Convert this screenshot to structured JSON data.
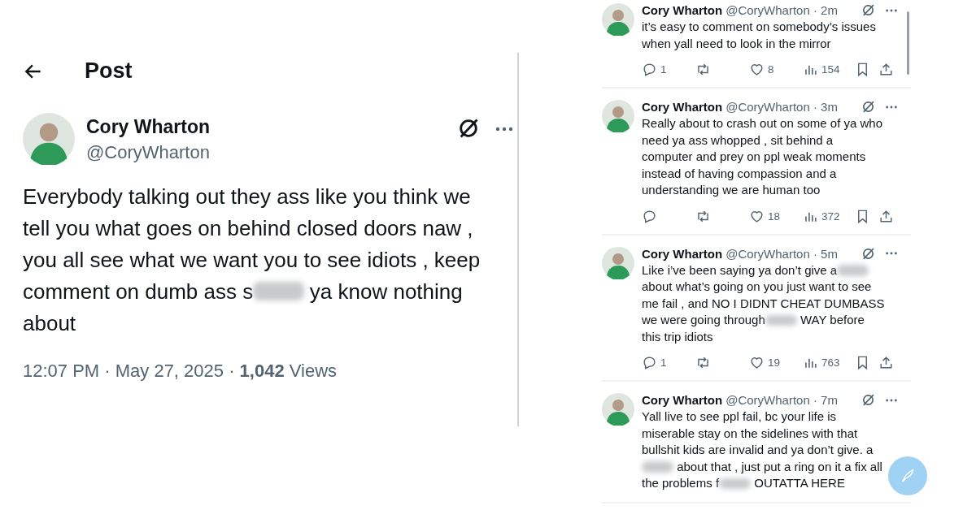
{
  "header": {
    "title": "Post"
  },
  "main_post": {
    "name": "Cory Wharton",
    "handle": "@CoryWharton",
    "body": [
      {
        "kind": "text",
        "text": "Everybody talking out they ass like you think we tell you what goes on behind closed doors naw , you all see what we want you to see idiots , keep comment on dumb ass s"
      },
      {
        "kind": "blur"
      },
      {
        "kind": "text",
        "text": " ya know nothing about"
      }
    ],
    "footer": "12:07 PM · May 27, 2025 · **1,042** Views"
  },
  "replies": [
    {
      "name": "Cory Wharton",
      "meta": "@CoryWharton · 2m",
      "body": [
        {
          "kind": "text",
          "text": "it’s easy to comment on somebody’s issues when yall need to look in the mirror"
        }
      ],
      "reply_count": "1",
      "likes": "8",
      "views": "154"
    },
    {
      "name": "Cory Wharton",
      "meta": "@CoryWharton · 3m",
      "body": [
        {
          "kind": "text",
          "text": "Really about to crash out on some of ya who need ya ass whopped , sit behind a computer and prey on ppl weak moments instead of having compassion and a understanding we are human too"
        }
      ],
      "likes": "18",
      "views": "372"
    },
    {
      "name": "Cory Wharton",
      "meta": "@CoryWharton · 5m",
      "body": [
        {
          "kind": "text",
          "text": "Like i’ve been saying ya don’t give a"
        },
        {
          "kind": "blur"
        },
        {
          "kind": "text",
          "text": " about what’s going on you just want to see me fail , and NO I DIDNT CHEAT DUMBASS we were going through"
        },
        {
          "kind": "blur"
        },
        {
          "kind": "text",
          "text": " WAY before this trip idiots"
        }
      ],
      "reply_count": "1",
      "likes": "19",
      "views": "763"
    },
    {
      "name": "Cory Wharton",
      "meta": "@CoryWharton · 7m",
      "body": [
        {
          "kind": "text",
          "text": "Yall live to see ppl fail, bc your life is miserable stay on the sidelines with that bullshit kids are invalid and ya don’t give. a "
        },
        {
          "kind": "blur"
        },
        {
          "kind": "text",
          "text": " about that , just put a ring on it a fix all the problems f"
        },
        {
          "kind": "blur"
        },
        {
          "kind": "text",
          "text": " OUTATTA HERE"
        }
      ]
    }
  ]
}
